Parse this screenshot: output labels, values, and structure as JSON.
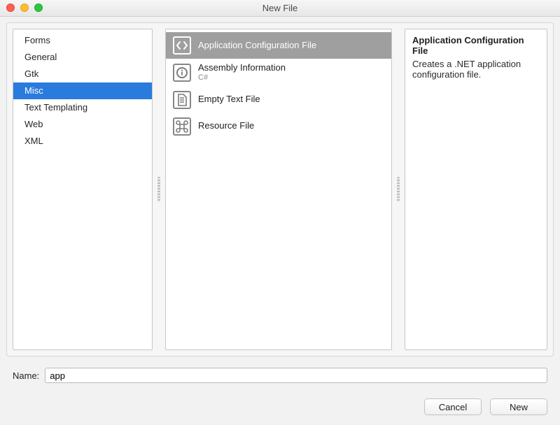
{
  "window": {
    "title": "New File"
  },
  "categories": [
    {
      "label": "Forms",
      "selected": false
    },
    {
      "label": "General",
      "selected": false
    },
    {
      "label": "Gtk",
      "selected": false
    },
    {
      "label": "Misc",
      "selected": true
    },
    {
      "label": "Text Templating",
      "selected": false
    },
    {
      "label": "Web",
      "selected": false
    },
    {
      "label": "XML",
      "selected": false
    }
  ],
  "templates": [
    {
      "label": "Application Configuration File",
      "subtitle": "",
      "icon": "code",
      "selected": true
    },
    {
      "label": "Assembly Information",
      "subtitle": "C#",
      "icon": "info",
      "selected": false
    },
    {
      "label": "Empty Text File",
      "subtitle": "",
      "icon": "page",
      "selected": false
    },
    {
      "label": "Resource File",
      "subtitle": "",
      "icon": "cmd",
      "selected": false
    }
  ],
  "description": {
    "title": "Application Configuration File",
    "body": "Creates a .NET application configuration file."
  },
  "form": {
    "name_label": "Name:",
    "name_value": "app"
  },
  "buttons": {
    "cancel": "Cancel",
    "new": "New"
  }
}
